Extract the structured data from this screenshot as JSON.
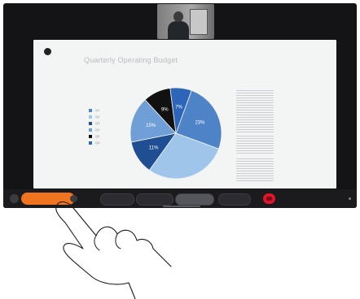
{
  "slide": {
    "title": "Quarterly Operating Budget",
    "legend": [
      {
        "label": "Q1",
        "color": "#4f83c8"
      },
      {
        "label": "Q2",
        "color": "#9fc6ea"
      },
      {
        "label": "Q3",
        "color": "#1f4f92"
      },
      {
        "label": "Q4",
        "color": "#6f9fd6"
      },
      {
        "label": "Q5",
        "color": "#111111"
      },
      {
        "label": "Q6",
        "color": "#2d66b8"
      }
    ]
  },
  "chart_data": {
    "type": "pie",
    "slices": [
      {
        "label": "23%",
        "value": 23,
        "color": "#4f83c8"
      },
      {
        "label": "",
        "value": 27,
        "color": "#9fc6ea"
      },
      {
        "label": "11%",
        "value": 11,
        "color": "#1f4f92"
      },
      {
        "label": "15%",
        "value": 15,
        "color": "#6f9fd6"
      },
      {
        "label": "9%",
        "value": 9,
        "color": "#111111"
      },
      {
        "label": "7%",
        "value": 7,
        "color": "#2d66b8"
      }
    ]
  },
  "toolbar": {
    "active_label": "",
    "buttons": [
      {
        "name": "mute-button",
        "label": "",
        "selected": false
      },
      {
        "name": "video-button",
        "label": "",
        "selected": false
      },
      {
        "name": "share-button",
        "label": "",
        "selected": true
      },
      {
        "name": "more-button",
        "label": "",
        "selected": false
      }
    ],
    "accent": "#f0741f",
    "end_color": "#e0142b"
  }
}
